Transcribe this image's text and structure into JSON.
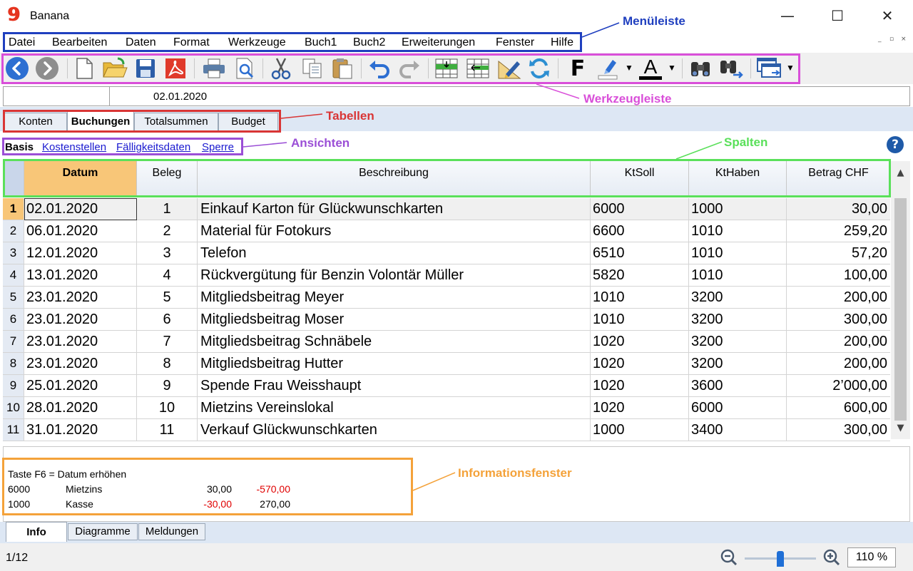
{
  "window": {
    "title": "Banana",
    "logo_text": "9",
    "minimize": "—",
    "maximize": "☐",
    "close": "✕"
  },
  "menu": [
    "Datei",
    "Bearbeiten",
    "Daten",
    "Format",
    "Werkzeuge",
    "Buch1",
    "Buch2",
    "Erweiterungen",
    "Fenster",
    "Hilfe"
  ],
  "mdi_controls": [
    "_",
    "▫",
    "×"
  ],
  "toolbar": {
    "icons": [
      "back-icon",
      "forward-icon",
      "new-file-icon",
      "open-file-icon",
      "save-icon",
      "pdf-icon",
      "print-icon",
      "print-preview-icon",
      "cut-icon",
      "copy-icon",
      "paste-icon",
      "undo-icon",
      "redo-icon",
      "insert-row-icon",
      "delete-row-icon",
      "edit-pencil-icon",
      "recalculate-icon",
      "bold-icon",
      "highlight-icon",
      "font-color-icon",
      "find-icon",
      "find-next-icon",
      "window-icon"
    ],
    "bold_text": "F",
    "font_color_text": "A"
  },
  "cellbar": {
    "value": "02.01.2020"
  },
  "tables_tabs": [
    "Konten",
    "Buchungen",
    "Totalsummen",
    "Budget"
  ],
  "active_table_tab": "Buchungen",
  "views": [
    "Basis",
    "Kostenstellen",
    "Fälligkeitsdaten",
    "Sperre"
  ],
  "active_view": "Basis",
  "help": "?",
  "columns": [
    "Datum",
    "Beleg",
    "Beschreibung",
    "KtSoll",
    "KtHaben",
    "Betrag CHF"
  ],
  "rows": [
    {
      "n": "1",
      "datum": "02.01.2020",
      "beleg": "1",
      "desc": "Einkauf Karton für Glückwunschkarten",
      "soll": "6000",
      "haben": "1000",
      "betrag": "30,00"
    },
    {
      "n": "2",
      "datum": "06.01.2020",
      "beleg": "2",
      "desc": "Material für Fotokurs",
      "soll": "6600",
      "haben": "1010",
      "betrag": "259,20"
    },
    {
      "n": "3",
      "datum": "12.01.2020",
      "beleg": "3",
      "desc": "Telefon",
      "soll": "6510",
      "haben": "1010",
      "betrag": "57,20"
    },
    {
      "n": "4",
      "datum": "13.01.2020",
      "beleg": "4",
      "desc": "Rückvergütung für Benzin Volontär Müller",
      "soll": "5820",
      "haben": "1010",
      "betrag": "100,00"
    },
    {
      "n": "5",
      "datum": "23.01.2020",
      "beleg": "5",
      "desc": "Mitgliedsbeitrag Meyer",
      "soll": "1010",
      "haben": "3200",
      "betrag": "200,00"
    },
    {
      "n": "6",
      "datum": "23.01.2020",
      "beleg": "6",
      "desc": "Mitgliedsbeitrag Moser",
      "soll": "1010",
      "haben": "3200",
      "betrag": "300,00"
    },
    {
      "n": "7",
      "datum": "23.01.2020",
      "beleg": "7",
      "desc": "Mitgliedsbeitrag Schnäbele",
      "soll": "1020",
      "haben": "3200",
      "betrag": "200,00"
    },
    {
      "n": "8",
      "datum": "23.01.2020",
      "beleg": "8",
      "desc": "Mitgliedsbeitrag Hutter",
      "soll": "1020",
      "haben": "3200",
      "betrag": "200,00"
    },
    {
      "n": "9",
      "datum": "25.01.2020",
      "beleg": "9",
      "desc": "Spende Frau Weisshaupt",
      "soll": "1020",
      "haben": "3600",
      "betrag": "2’000,00"
    },
    {
      "n": "10",
      "datum": "28.01.2020",
      "beleg": "10",
      "desc": "Mietzins Vereinslokal",
      "soll": "1020",
      "haben": "6000",
      "betrag": "600,00"
    },
    {
      "n": "11",
      "datum": "31.01.2020",
      "beleg": "11",
      "desc": "Verkauf Glückwunschkarten",
      "soll": "1000",
      "haben": "3400",
      "betrag": "300,00"
    }
  ],
  "info": {
    "hint": "Taste F6 = Datum erhöhen",
    "lines": [
      {
        "account": "6000",
        "name": "Mietzins",
        "amount": "30,00",
        "balance": "-570,00"
      },
      {
        "account": "1000",
        "name": "Kasse",
        "amount": "-30,00",
        "balance": "270,00"
      }
    ]
  },
  "bottom_tabs": [
    "Info",
    "Diagramme",
    "Meldungen"
  ],
  "active_bottom_tab": "Info",
  "status": {
    "page": "1/12",
    "zoom": "110 %",
    "zoom_level_percent": 110
  },
  "annotations": {
    "menu": {
      "label": "Menüleiste",
      "color": "#1f3fbf"
    },
    "toolbar": {
      "label": "Werkzeugleiste",
      "color": "#d94fd9"
    },
    "tables": {
      "label": "Tabellen",
      "color": "#d93535"
    },
    "views": {
      "label": "Ansichten",
      "color": "#9b4fd6"
    },
    "columns": {
      "label": "Spalten",
      "color": "#5ae05a"
    },
    "info": {
      "label": "Informationsfenster",
      "color": "#f4a23a"
    }
  }
}
